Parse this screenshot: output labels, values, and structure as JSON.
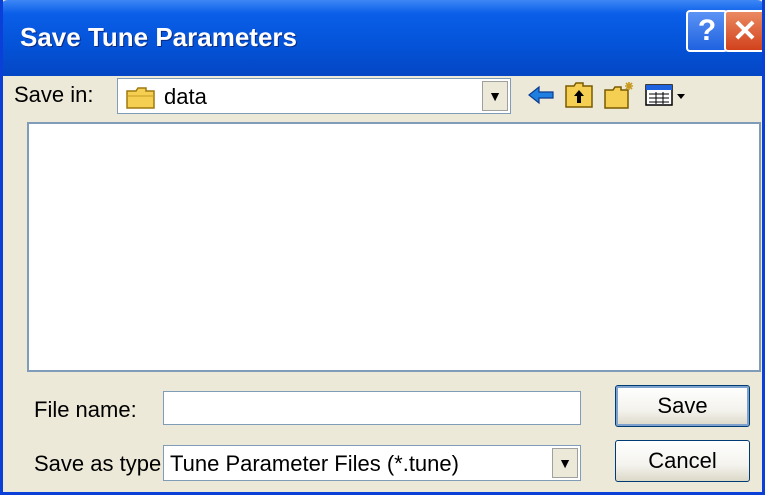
{
  "window": {
    "title": "Save Tune Parameters",
    "help_glyph": "?",
    "close_glyph": "✕"
  },
  "save_in": {
    "label": "Save in:",
    "value": "data",
    "arrow": "▼"
  },
  "toolbar": {
    "icons": [
      "back-arrow-icon",
      "up-one-level-icon",
      "new-folder-icon",
      "view-menu-icon"
    ]
  },
  "file_list": {
    "items": []
  },
  "file_name": {
    "label": "File name:",
    "value": "",
    "placeholder": ""
  },
  "save_as_type": {
    "label": "Save as type:",
    "value": "Tune Parameter Files (*.tune)",
    "arrow": "▼"
  },
  "buttons": {
    "save_label": "Save",
    "cancel_label": "Cancel"
  },
  "colors": {
    "titlebar": "#0453d8",
    "dialog_bg": "#ece9d8",
    "close_button": "#d1411b",
    "folder_yellow": "#f5cf52"
  }
}
